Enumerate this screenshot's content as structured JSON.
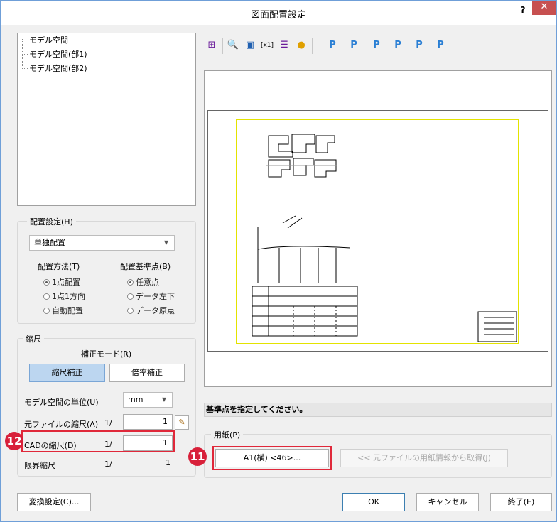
{
  "window": {
    "title": "図面配置設定",
    "help_label": "?",
    "close_label": "✕"
  },
  "tree": {
    "items": [
      "モデル空間",
      "モデル空間(部1)",
      "モデル空間(部2)"
    ]
  },
  "placement": {
    "legend": "配置設定(H)",
    "mode_value": "単独配置",
    "method_label": "配置方法(T)",
    "method_options": [
      "1点配置",
      "1点1方向",
      "自動配置"
    ],
    "method_selected": 0,
    "basepoint_label": "配置基準点(B)",
    "basepoint_options": [
      "任意点",
      "データ左下",
      "データ原点"
    ],
    "basepoint_selected": 0
  },
  "scale": {
    "legend": "縮尺",
    "correction_mode_label": "補正モード(R)",
    "scale_correction_button": "縮尺補正",
    "ratio_correction_button": "倍率補正",
    "unit_label": "モデル空間の単位(U)",
    "unit_value": "mm",
    "source_scale_label": "元ファイルの縮尺(A)",
    "source_prefix": "1/",
    "source_value": "1",
    "cad_scale_label": "CADの縮尺(D)",
    "cad_prefix": "1/",
    "cad_value": "1",
    "limit_label": "限界縮尺",
    "limit_prefix": "1/",
    "limit_value": "1"
  },
  "status_message": "基準点を指定してください。",
  "paper": {
    "legend": "用紙(P)",
    "size_button": "A1(横) <46>...",
    "fetch_button": "<< 元ファイルの用紙情報から取得(J)"
  },
  "footer": {
    "convert_button": "変換設定(C)...",
    "ok_button": "OK",
    "cancel_button": "キャンセル",
    "exit_button": "終了(E)"
  },
  "annotations": {
    "badge_cad": "12",
    "badge_paper": "11"
  },
  "colors": {
    "highlight": "#e0283a",
    "badge": "#d8203a",
    "pressed": "#bcd6f0",
    "frame": "#e3e300"
  },
  "toolbar_icons": [
    "sheet-info-icon",
    "zoom-icon",
    "fit-icon",
    "scale-1-icon",
    "list-icon",
    "bulb-icon",
    "point-p-icon",
    "point-p-left-icon",
    "point-p-center-icon",
    "point-p-right-icon",
    "point-p-top-icon",
    "point-p-rotate-icon"
  ]
}
